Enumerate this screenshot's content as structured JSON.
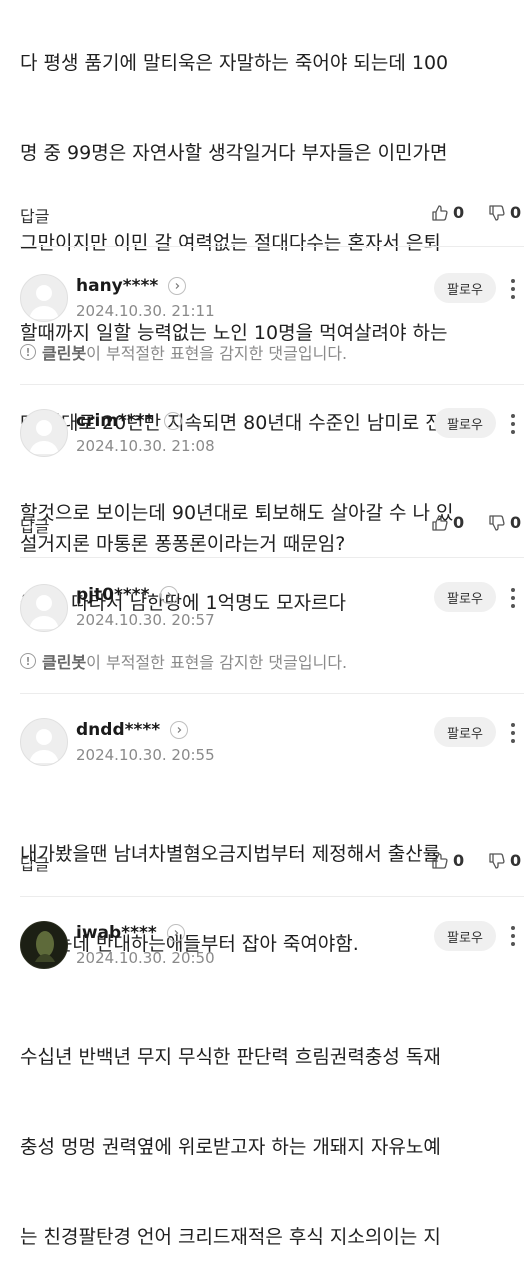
{
  "top_comment": {
    "lines": [
      "다 평생 품기에 말티욱은 자말하는 죽어야 되는데 100",
      "명 중 99명은 자연사할 생각일거다 부자들은 이민가면",
      "그만이지만 이민 갈 여력없는 절대다수는 혼자서 은퇴",
      "할때까지 일할 능력없는 노인 10명을 먹여살려야 하는",
      "데 이대로 20년만 지속되면 80년대 수준인 남미로 전락",
      "할것으로 보이는데 90년대로 퇴보해도 살아갈 수 나 있",
      "을까? 따라서 남한땅에 1억명도 모자르다"
    ],
    "reply_label": "답글",
    "likes": "0",
    "dislikes": "0"
  },
  "comments": [
    {
      "username": "hany****",
      "timestamp": "2024.10.30. 21:11",
      "follow_label": "팔로우",
      "cleanbot_label": "클린봇",
      "cleanbot_notice": "이 부적절한 표현을 감지한 댓글입니다."
    },
    {
      "username": "crim****",
      "timestamp": "2024.10.30. 21:08",
      "follow_label": "팔로우",
      "lines": [
        "설거지론 마통론 퐁퐁론이라는거 때문임?"
      ],
      "reply_label": "답글",
      "likes": "0",
      "dislikes": "0"
    },
    {
      "username": "pjt0****",
      "timestamp": "2024.10.30. 20:57",
      "follow_label": "팔로우",
      "cleanbot_label": "클린봇",
      "cleanbot_notice": "이 부적절한 표현을 감지한 댓글입니다."
    },
    {
      "username": "dndd****",
      "timestamp": "2024.10.30. 20:55",
      "follow_label": "팔로우",
      "lines": [
        "내가봤을땐 남녀차별혐오금지법부터 제정해서 출산률",
        "높이는데 반대하는애들부터 잡아 죽여야함."
      ],
      "reply_label": "답글",
      "likes": "0",
      "dislikes": "0"
    },
    {
      "username": "iwab****",
      "timestamp": "2024.10.30. 20:50",
      "follow_label": "팔로우",
      "lines": [
        "수십년 반백년 무지 무식한 판단력 흐림권력충성 독재",
        "충성 멍멍 권력옆에 위로받고자 하는 개돼지 자유노예",
        "는 친경팔탄경 언어 크리드재적은 후식 지소의이는 지"
      ]
    }
  ],
  "icons": {
    "like": "thumbs-up-icon",
    "dislike": "thumbs-down-icon",
    "more": "more-vertical-icon",
    "profile_link": "chevron-right-icon",
    "cleanbot": "alert-circle-icon"
  },
  "colors": {
    "text": "#1f1f1f",
    "muted": "#8a8a8a",
    "follow_bg": "#f0f0f0",
    "divider": "#ececec"
  }
}
